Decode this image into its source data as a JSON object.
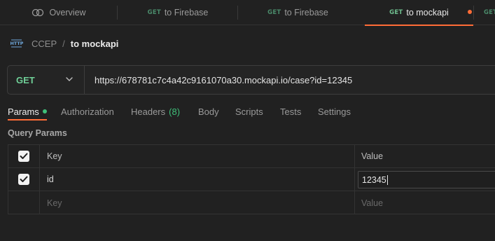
{
  "tabs": [
    {
      "label": "Overview",
      "method": ""
    },
    {
      "label": "to Firebase",
      "method": "GET"
    },
    {
      "label": "to Firebase",
      "method": "GET"
    },
    {
      "label": "to mockapi",
      "method": "GET"
    },
    {
      "label": "",
      "method": "GET"
    }
  ],
  "breadcrumb": {
    "collection": "CCEP",
    "separator": "/",
    "request": "to mockapi"
  },
  "request": {
    "method": "GET",
    "url": "https://678781c7c4a42c9161070a30.mockapi.io/case?id=12345"
  },
  "subtabs": {
    "params": "Params",
    "authorization": "Authorization",
    "headers": "Headers",
    "headers_count": "(8)",
    "body": "Body",
    "scripts": "Scripts",
    "tests": "Tests",
    "settings": "Settings"
  },
  "query_params": {
    "title": "Query Params",
    "columns": {
      "key": "Key",
      "value": "Value"
    },
    "rows": [
      {
        "key": "id",
        "value": "12345",
        "checked": true
      }
    ],
    "placeholder": {
      "key": "Key",
      "value": "Value"
    }
  },
  "colors": {
    "accent": "#ff6c37",
    "get_method": "#6fcf97",
    "status_green": "#3fc07a"
  },
  "icons": [
    "overview-icon",
    "http-request-icon",
    "chevron-down-icon",
    "checkmark-icon"
  ]
}
